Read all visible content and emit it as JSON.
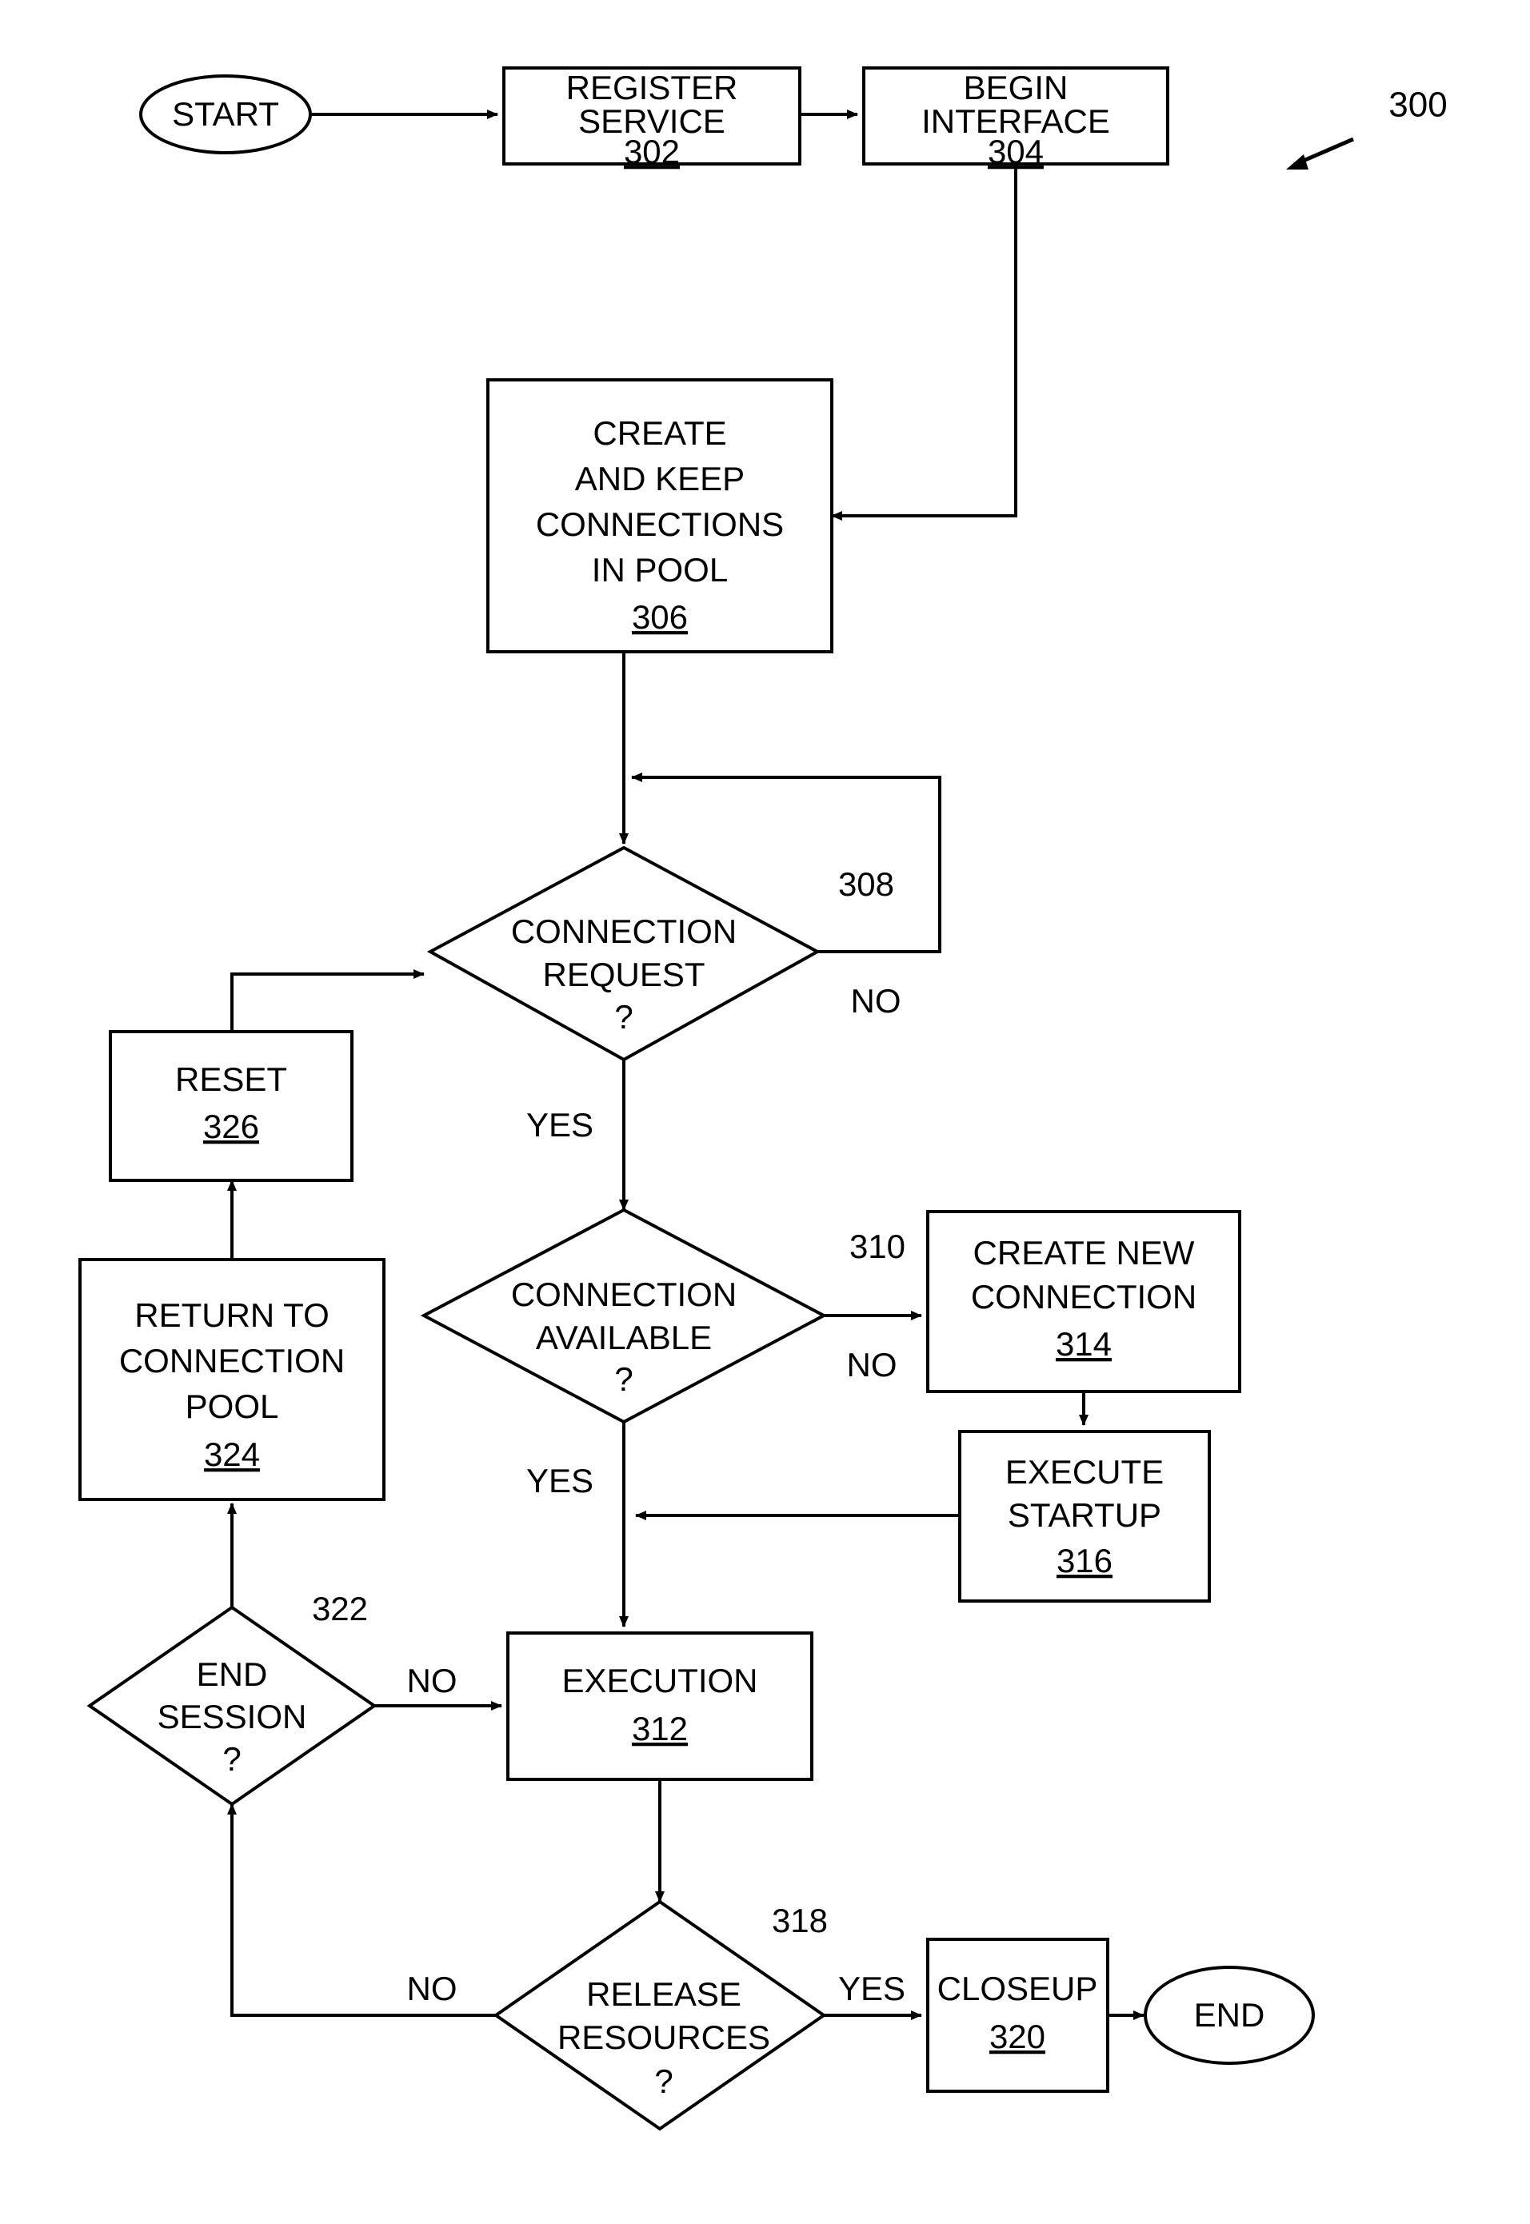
{
  "figure": {
    "callout_label": "300"
  },
  "nodes": {
    "start": {
      "label": "START"
    },
    "register_service": {
      "line1": "REGISTER",
      "line2": "SERVICE",
      "ref": "302"
    },
    "begin_interface": {
      "line1": "BEGIN",
      "line2": "INTERFACE",
      "ref": "304"
    },
    "create_keep_pool": {
      "line1": "CREATE",
      "line2": "AND KEEP",
      "line3": "CONNECTIONS",
      "line4": "IN POOL",
      "ref": "306"
    },
    "connection_request": {
      "line1": "CONNECTION",
      "line2": "REQUEST",
      "line3": "?",
      "ref": "308"
    },
    "reset": {
      "line1": "RESET",
      "ref": "326"
    },
    "connection_available": {
      "line1": "CONNECTION",
      "line2": "AVAILABLE",
      "line3": "?",
      "ref": "310"
    },
    "create_new_connection": {
      "line1": "CREATE NEW",
      "line2": "CONNECTION",
      "ref": "314"
    },
    "execute_startup": {
      "line1": "EXECUTE",
      "line2": "STARTUP",
      "ref": "316"
    },
    "return_to_pool": {
      "line1": "RETURN TO",
      "line2": "CONNECTION",
      "line3": "POOL",
      "ref": "324"
    },
    "end_session": {
      "line1": "END",
      "line2": "SESSION",
      "line3": "?",
      "ref": "322"
    },
    "execution": {
      "line1": "EXECUTION",
      "ref": "312"
    },
    "release_resources": {
      "line1": "RELEASE",
      "line2": "RESOURCES",
      "line3": "?",
      "ref": "318"
    },
    "closeup": {
      "line1": "CLOSEUP",
      "ref": "320"
    },
    "end": {
      "label": "END"
    }
  },
  "edge_labels": {
    "request_no": "NO",
    "request_yes": "YES",
    "available_no": "NO",
    "available_yes": "YES",
    "end_session_no": "NO",
    "release_no": "NO",
    "release_yes": "YES"
  },
  "colors": {
    "stroke": "#000000",
    "fill": "#ffffff"
  }
}
